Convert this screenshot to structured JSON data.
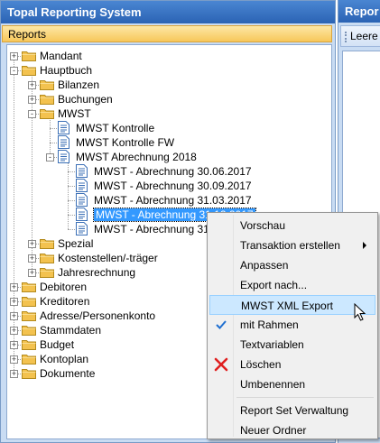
{
  "left_window": {
    "title": "Topal Reporting System"
  },
  "reports_header": {
    "label": "Reports"
  },
  "right_window": {
    "title": "Repor",
    "empty_button": "Leere"
  },
  "tree": [
    {
      "label": "Mandant",
      "level": 0,
      "kind": "folder",
      "expander": "+"
    },
    {
      "label": "Hauptbuch",
      "level": 0,
      "kind": "folder",
      "expander": "-"
    },
    {
      "label": "Bilanzen",
      "level": 1,
      "kind": "folder",
      "expander": "+"
    },
    {
      "label": "Buchungen",
      "level": 1,
      "kind": "folder",
      "expander": "+"
    },
    {
      "label": "MWST",
      "level": 1,
      "kind": "folder",
      "expander": "-"
    },
    {
      "label": "MWST Kontrolle",
      "level": 2,
      "kind": "doc"
    },
    {
      "label": "MWST Kontrolle FW",
      "level": 2,
      "kind": "doc"
    },
    {
      "label": "MWST Abrechnung 2018",
      "level": 2,
      "kind": "doc",
      "expander": "-"
    },
    {
      "label": "MWST - Abrechnung 30.06.2017",
      "level": 3,
      "kind": "doc"
    },
    {
      "label": "MWST - Abrechnung 30.09.2017",
      "level": 3,
      "kind": "doc"
    },
    {
      "label": "MWST - Abrechnung 31.03.2017",
      "level": 3,
      "kind": "doc"
    },
    {
      "label": "MWST - Abrechnung 31.12.2017",
      "level": 3,
      "kind": "doc",
      "selected": true
    },
    {
      "label": "MWST - Abrechnung 31.1",
      "level": 3,
      "kind": "doc"
    },
    {
      "label": "Spezial",
      "level": 1,
      "kind": "folder",
      "expander": "+"
    },
    {
      "label": "Kostenstellen/-träger",
      "level": 1,
      "kind": "folder",
      "expander": "+"
    },
    {
      "label": "Jahresrechnung",
      "level": 1,
      "kind": "folder",
      "expander": "+"
    },
    {
      "label": "Debitoren",
      "level": 0,
      "kind": "folder",
      "expander": "+"
    },
    {
      "label": "Kreditoren",
      "level": 0,
      "kind": "folder",
      "expander": "+"
    },
    {
      "label": "Adresse/Personenkonto",
      "level": 0,
      "kind": "folder",
      "expander": "+"
    },
    {
      "label": "Stammdaten",
      "level": 0,
      "kind": "folder",
      "expander": "+"
    },
    {
      "label": "Budget",
      "level": 0,
      "kind": "folder",
      "expander": "+"
    },
    {
      "label": "Kontoplan",
      "level": 0,
      "kind": "folder",
      "expander": "+"
    },
    {
      "label": "Dokumente",
      "level": 0,
      "kind": "folder",
      "expander": "+"
    }
  ],
  "context_menu": {
    "items": [
      {
        "label": "Vorschau"
      },
      {
        "label": "Transaktion erstellen",
        "submenu": true
      },
      {
        "label": "Anpassen"
      },
      {
        "label": "Export nach..."
      },
      {
        "label": "MWST XML Export",
        "hover": true
      },
      {
        "label": "mit Rahmen",
        "icon": "checkmark-icon"
      },
      {
        "label": "Textvariablen"
      },
      {
        "label": "Löschen",
        "icon": "delete-x-icon"
      },
      {
        "label": "Umbenennen"
      },
      {
        "separator": true
      },
      {
        "label": "Report Set Verwaltung"
      },
      {
        "label": "Neuer Ordner"
      }
    ]
  },
  "colors": {
    "title_bar": "#2b63b4",
    "header_gold": "#f7c75a",
    "selection": "#3399ff",
    "menu_hover": "#cce8ff",
    "delete_red": "#e02020",
    "check_blue": "#1f6fd0"
  }
}
